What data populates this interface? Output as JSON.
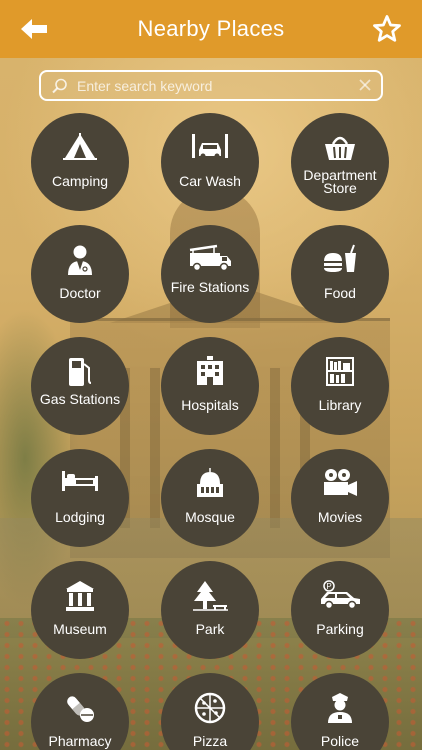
{
  "header": {
    "title": "Nearby Places",
    "back_icon": "back-arrow-icon",
    "favorite_icon": "star-outline-icon",
    "color": "#e09a2a"
  },
  "search": {
    "placeholder": "Enter search keyword",
    "value": ""
  },
  "categories": [
    {
      "label": "Camping",
      "icon": "tent-icon"
    },
    {
      "label": "Car Wash",
      "icon": "car-wash-icon"
    },
    {
      "label": "Department Store",
      "icon": "basket-icon"
    },
    {
      "label": "Doctor",
      "icon": "doctor-icon"
    },
    {
      "label": "Fire Stations",
      "icon": "fire-truck-icon"
    },
    {
      "label": "Food",
      "icon": "burger-drink-icon"
    },
    {
      "label": "Gas Stations",
      "icon": "gas-pump-icon"
    },
    {
      "label": "Hospitals",
      "icon": "hospital-building-icon"
    },
    {
      "label": "Library",
      "icon": "bookshelf-icon"
    },
    {
      "label": "Lodging",
      "icon": "bed-icon"
    },
    {
      "label": "Mosque",
      "icon": "mosque-dome-icon"
    },
    {
      "label": "Movies",
      "icon": "movie-camera-icon"
    },
    {
      "label": "Museum",
      "icon": "museum-icon"
    },
    {
      "label": "Park",
      "icon": "tree-bench-icon"
    },
    {
      "label": "Parking",
      "icon": "parking-car-icon"
    },
    {
      "label": "Pharmacy",
      "icon": "pill-icon"
    },
    {
      "label": "Pizza",
      "icon": "pizza-icon"
    },
    {
      "label": "Police",
      "icon": "police-officer-icon"
    }
  ]
}
